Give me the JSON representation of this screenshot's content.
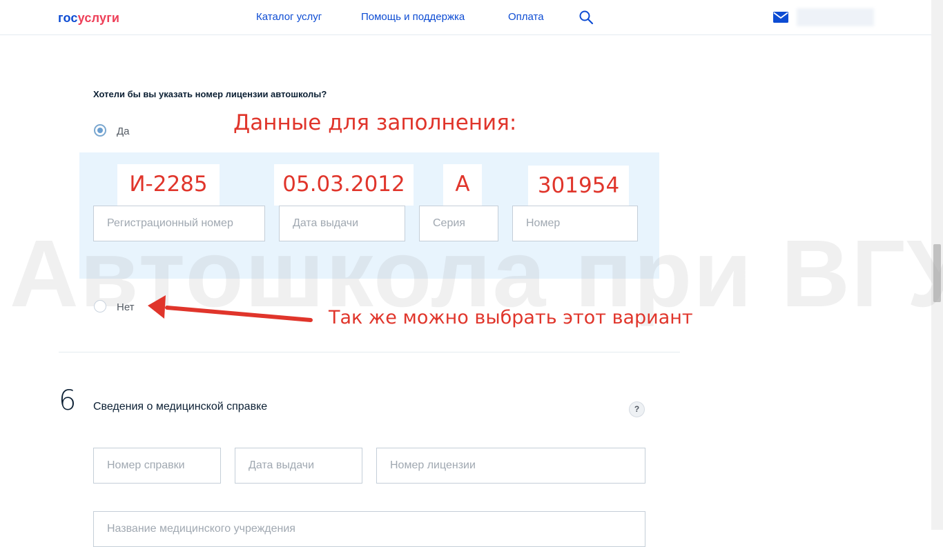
{
  "header": {
    "logo_part1": "гос",
    "logo_part2": "услуги",
    "nav": [
      "Каталог услуг",
      "Помощь и поддержка",
      "Оплата"
    ],
    "search_icon": "search-icon",
    "mail_icon": "mail-icon"
  },
  "watermark": "Автошкола при ВГУ",
  "license": {
    "question": "Хотели бы вы указать номер лицензии автошколы?",
    "option_yes": "Да",
    "option_no": "Нет",
    "selected": "Да",
    "placeholders": {
      "reg_number": "Регистрационный номер",
      "issue_date": "Дата выдачи",
      "series": "Серия",
      "number": "Номер"
    }
  },
  "annotations": {
    "fill_heading": "Данные для заполнения:",
    "values": {
      "reg_number": "И-2285",
      "issue_date": "05.03.2012",
      "series": "А",
      "number": "301954"
    },
    "alt_option_note": "Так же можно выбрать этот вариант",
    "annotation_color": "#e0352b"
  },
  "medical": {
    "section_number": "6",
    "title": "Сведения о медицинской справке",
    "help_label": "?",
    "placeholders": {
      "certificate_number": "Номер справки",
      "issue_date": "Дата выдачи",
      "license_number": "Номер лицензии",
      "institution_name": "Название медицинского учреждения"
    }
  },
  "colors": {
    "link": "#0d4cd3",
    "brand_red": "#ee3f58",
    "panel_bg": "#e8f4fd"
  }
}
